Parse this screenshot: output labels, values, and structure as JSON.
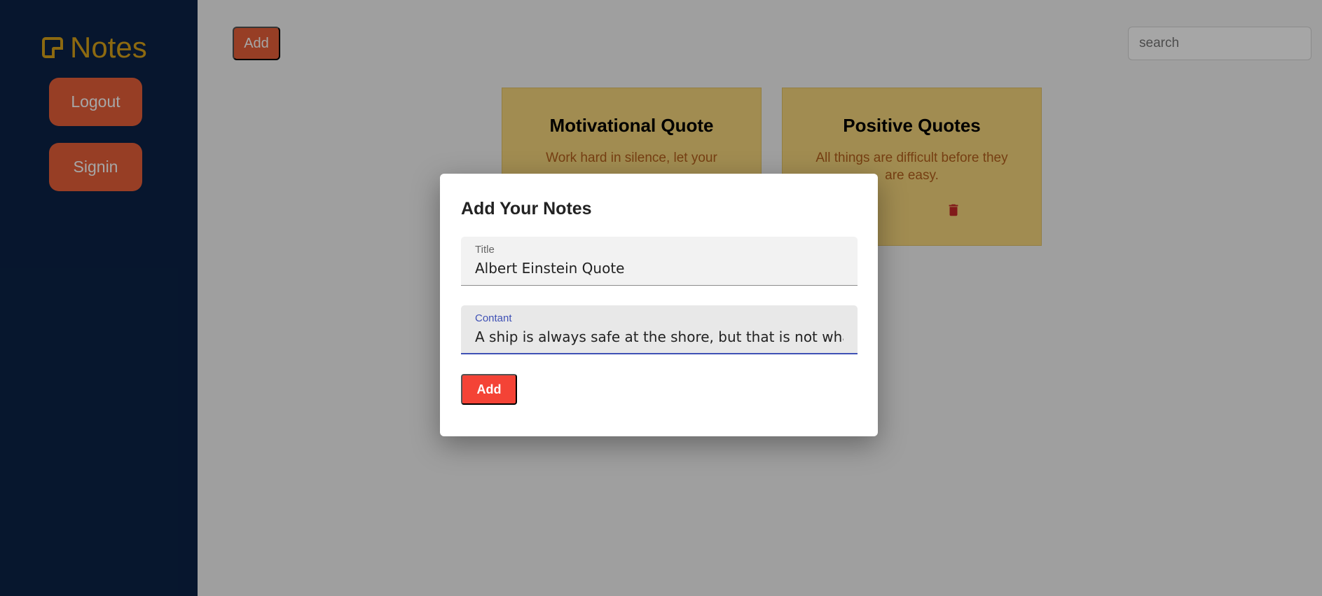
{
  "sidebar": {
    "brand": "Notes",
    "brand_icon": "sticky-note-icon",
    "logout_label": "Logout",
    "signin_label": "Signin"
  },
  "toolbar": {
    "add_label": "Add",
    "search_placeholder": "search"
  },
  "notes": [
    {
      "title": "Motivational Quote",
      "content": "Work hard in silence, let your"
    },
    {
      "title": "Positive Quotes",
      "content": "All things are difficult before they are easy.",
      "edit_icon": "edit-icon",
      "delete_icon": "trash-icon"
    }
  ],
  "modal": {
    "title": "Add Your Notes",
    "title_field_label": "Title",
    "title_field_value": "Albert Einstein Quote",
    "content_field_label": "Contant",
    "content_field_value": "A ship is always safe at the shore, but that is not what it",
    "add_label": "Add"
  },
  "colors": {
    "sidebar_bg": "#0b2347",
    "brand": "#d8a21a",
    "accent_button": "#e8603a",
    "modal_button": "#f44336",
    "card_bg": "#f7d77d",
    "focus_underline": "#3f51b5",
    "delete_icon": "#c62828"
  }
}
